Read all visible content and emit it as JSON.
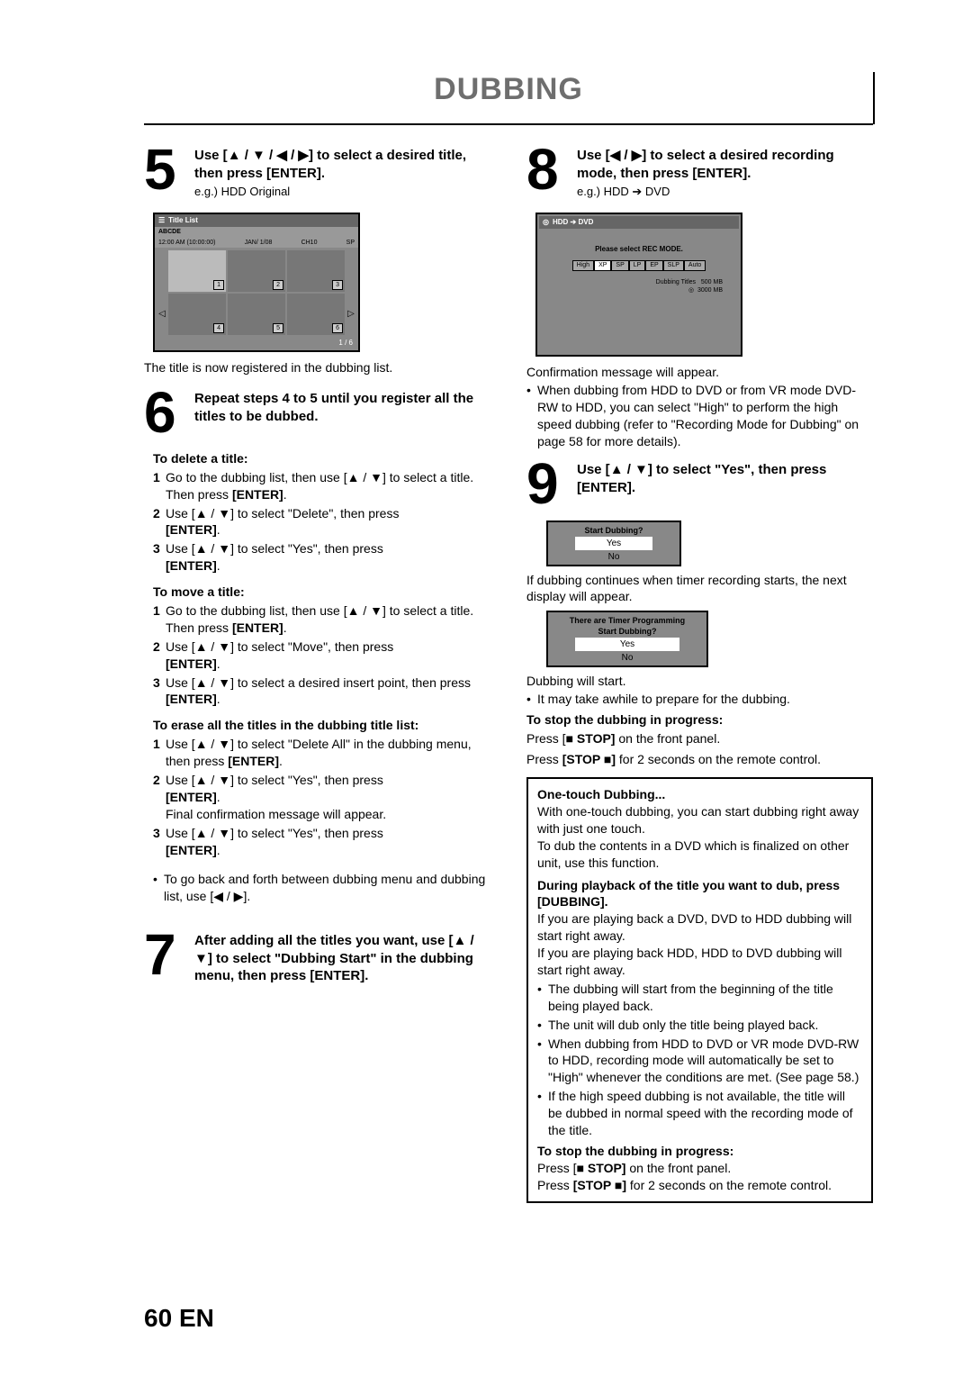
{
  "page": {
    "title": "DUBBING",
    "number": "60",
    "lang": "EN"
  },
  "step5": {
    "num": "5",
    "head_a": "Use [",
    "head_b": "] to select a desired title, then press [ENTER].",
    "arrows": "▲ / ▼ / ◀ / ▶",
    "eg": "e.g.) HDD Original",
    "after": "The title is now registered in the dubbing list."
  },
  "titlelist": {
    "head": "Title List",
    "abcde": "ABCDE",
    "meta_time": "12:00 AM (10:00:00)",
    "meta_date": "JAN/  1/08",
    "meta_ch": "CH10",
    "meta_sp": "SP",
    "badges": [
      "1",
      "2",
      "3",
      "4",
      "5",
      "6"
    ],
    "foot": "1 / 6"
  },
  "step6": {
    "num": "6",
    "head": "Repeat steps 4 to 5 until you register all the titles to be dubbed.",
    "delete_head": "To delete a title:",
    "delete_1a": "Go to the dubbing list, then use [",
    "delete_arrows": "▲ / ▼",
    "delete_1b": "] to select a title. Then press ",
    "delete_1c": "[ENTER]",
    "delete_2a": "Use [",
    "delete_2b": "] to select \"Delete\", then press ",
    "delete_2c": "[ENTER]",
    "delete_3a": "Use [",
    "delete_3b": "] to select \"Yes\", then press ",
    "delete_3c": "[ENTER]",
    "move_head": "To move a title:",
    "move_1a": "Go to the dubbing list, then use [",
    "move_1b": "] to select a title. Then press ",
    "move_1c": "[ENTER]",
    "move_2a": "Use [",
    "move_2b": "] to select \"Move\", then press ",
    "move_2c": "[ENTER]",
    "move_3a": "Use [",
    "move_3b": "] to select a desired insert point, then press ",
    "move_3c": "[ENTER]",
    "erase_head": "To erase all the titles in the dubbing title list:",
    "erase_1a": "Use [",
    "erase_1b": "] to select \"Delete All\" in the dubbing menu, then press ",
    "erase_1c": "[ENTER]",
    "erase_2a": "Use [",
    "erase_2b": "] to select \"Yes\", then press ",
    "erase_2c": "[ENTER]",
    "erase_2d": "Final confirmation message will appear.",
    "erase_3a": "Use [",
    "erase_3b": "] to select \"Yes\", then press ",
    "erase_3c": "[ENTER]",
    "tip_a": "To go back and forth between dubbing menu and dubbing list, use [",
    "tip_arrows": "◀ / ▶",
    "tip_b": "]."
  },
  "step7": {
    "num": "7",
    "head_a": "After adding all the titles you want, use [",
    "arrows": "▲ / ▼",
    "head_b": "] to select \"Dubbing Start\" in the dubbing menu, then press [ENTER]."
  },
  "step8": {
    "num": "8",
    "head_a": "Use [",
    "arrows": "◀ / ▶",
    "head_b": "] to select a desired recording mode, then press [ENTER].",
    "eg": "e.g.) HDD ➔ DVD",
    "after": "Confirmation message will appear.",
    "bullet": "When dubbing from HDD to DVD or from VR mode DVD-RW to HDD, you can select \"High\" to perform the high speed dubbing (refer to \"Recording Mode for Dubbing\" on page 58 for more details)."
  },
  "recmode": {
    "head": "HDD ➔ DVD",
    "msg": "Please select REC MODE.",
    "modes": [
      "High",
      "XP",
      "SP",
      "LP",
      "EP",
      "SLP",
      "Auto"
    ],
    "size_label": "Dubbing Titles",
    "size_val1": "500 MB",
    "size_val2": "3000 MB"
  },
  "step9": {
    "num": "9",
    "head_a": "Use [",
    "arrows": "▲ / ▼",
    "head_b": "] to select \"Yes\", then press [ENTER].",
    "dialog1_head": "Start Dubbing?",
    "yes": "Yes",
    "no": "No",
    "mid": "If dubbing continues when timer recording starts, the next display will appear.",
    "dialog2_head1": "There are Timer Programming",
    "dialog2_head2": "Start Dubbing?",
    "after": "Dubbing will start.",
    "bullet": "It may take awhile to prepare for the dubbing.",
    "stop_head": "To stop the dubbing in progress:",
    "stop_1a": "Press [",
    "stop_1b": " STOP]",
    "stop_1c": " on the front panel.",
    "stop_2a": "Press ",
    "stop_2b": "[STOP ",
    "stop_2c": "]",
    "stop_2d": " for 2 seconds on the remote control."
  },
  "onetouch": {
    "title": "One-touch Dubbing...",
    "p1": "With one-touch dubbing, you can start dubbing right away with just one touch.",
    "p2": "To dub the contents in a DVD which is finalized on other unit, use this function.",
    "during_head": "During playback of the title you want to dub, press [DUBBING].",
    "p3": "If you are playing back a DVD, DVD to HDD dubbing will start right away.",
    "p4": "If you are playing back HDD, HDD to DVD dubbing will start right away.",
    "b1": "The dubbing will start from the beginning of the title being played back.",
    "b2": "The unit will dub only the title being played back.",
    "b3": "When dubbing from HDD to DVD or VR mode DVD-RW to HDD, recording mode will automatically be set to \"High\" whenever the conditions are met. (See page 58.)",
    "b4": "If the high speed dubbing is not available, the title will be dubbed in normal speed with the recording mode of the title.",
    "stop_head": "To stop the dubbing in progress:",
    "stop_1a": "Press [",
    "stop_1b": " STOP]",
    "stop_1c": " on the front panel.",
    "stop_2a": "Press ",
    "stop_2b": "[STOP ",
    "stop_2c": "]",
    "stop_2d": " for 2 seconds on the remote control."
  }
}
